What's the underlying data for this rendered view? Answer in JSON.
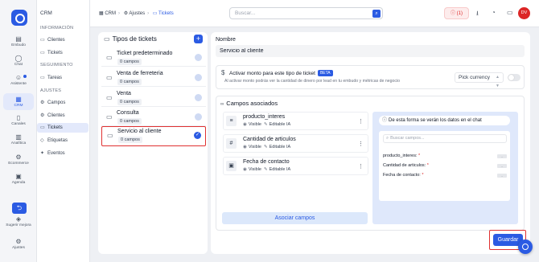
{
  "rail": {
    "items": [
      {
        "label": "Embudo",
        "icon": "funnel-icon"
      },
      {
        "label": "Chat",
        "icon": "chat-icon"
      },
      {
        "label": "Asistente",
        "icon": "robot-icon"
      },
      {
        "label": "CRM",
        "icon": "crm-icon"
      },
      {
        "label": "Canales",
        "icon": "phone-icon"
      },
      {
        "label": "Analítica",
        "icon": "chart-icon"
      },
      {
        "label": "Ecommerce",
        "icon": "cart-icon"
      },
      {
        "label": "Agenda",
        "icon": "calendar-icon"
      },
      {
        "label": "Sugerir mejora",
        "icon": "lightbulb-icon"
      },
      {
        "label": "Ajustes",
        "icon": "gear-icon"
      }
    ]
  },
  "sidebar": {
    "title": "CRM",
    "section_info": "INFORMACIÓN",
    "section_seg": "SEGUIMIENTO",
    "section_ajustes": "AJUSTES",
    "items": [
      {
        "label": "Clientes"
      },
      {
        "label": "Tickets"
      },
      {
        "label": "Tareas"
      },
      {
        "label": "Campos"
      },
      {
        "label": "Clientes"
      },
      {
        "label": "Tickets"
      },
      {
        "label": "Etiquetas"
      },
      {
        "label": "Eventos"
      }
    ]
  },
  "header": {
    "crumb_crm": "CRM",
    "crumb_ajustes": "Ajustes",
    "crumb_tickets": "Tickets",
    "search_placeholder": "Buscar...",
    "alert_count": "(1)",
    "avatar": "DV"
  },
  "tipos": {
    "title": "Tipos de tickets",
    "items": [
      {
        "name": "Ticket predeterminado",
        "count": "0 campos"
      },
      {
        "name": "Venta de ferreteria",
        "count": "0 campos"
      },
      {
        "name": "Venta",
        "count": "0 campos"
      },
      {
        "name": "Consulta",
        "count": "0 campos"
      },
      {
        "name": "Servicio al cliente",
        "count": "0 campos"
      }
    ]
  },
  "detail": {
    "nombre_label": "Nombre",
    "nombre_value": "Servicio al cliente",
    "monto_title": "Activar monto para este tipo de ticket",
    "beta": "BETA",
    "monto_desc": "Al activar monto podrás ver la cantidad de dinero por lead en tu embudo y métricas de negocio",
    "currency": "Pick currency",
    "campos_title": "Campos asociados",
    "fields": [
      {
        "name": "producto_interes",
        "icon": "text-lines-icon",
        "visible": "Visible",
        "editable": "Editable IA"
      },
      {
        "name": "Cantidad de articulos",
        "icon": "hash-icon",
        "visible": "Visible",
        "editable": "Editable IA"
      },
      {
        "name": "Fecha de contacto",
        "icon": "calendar-icon",
        "visible": "Visible",
        "editable": "Editable IA"
      }
    ],
    "asociar_label": "Asociar campos",
    "preview_title": "De esta forma se verán los datos en el chat",
    "preview_search": "Buscar campos...",
    "preview_rows": [
      {
        "label": "producto_interes:",
        "value": "-"
      },
      {
        "label": "Cantidad de articulos:",
        "value": "-"
      },
      {
        "label": "Fecha de contacto:",
        "value": "-"
      }
    ],
    "guardar": "Guardar"
  }
}
